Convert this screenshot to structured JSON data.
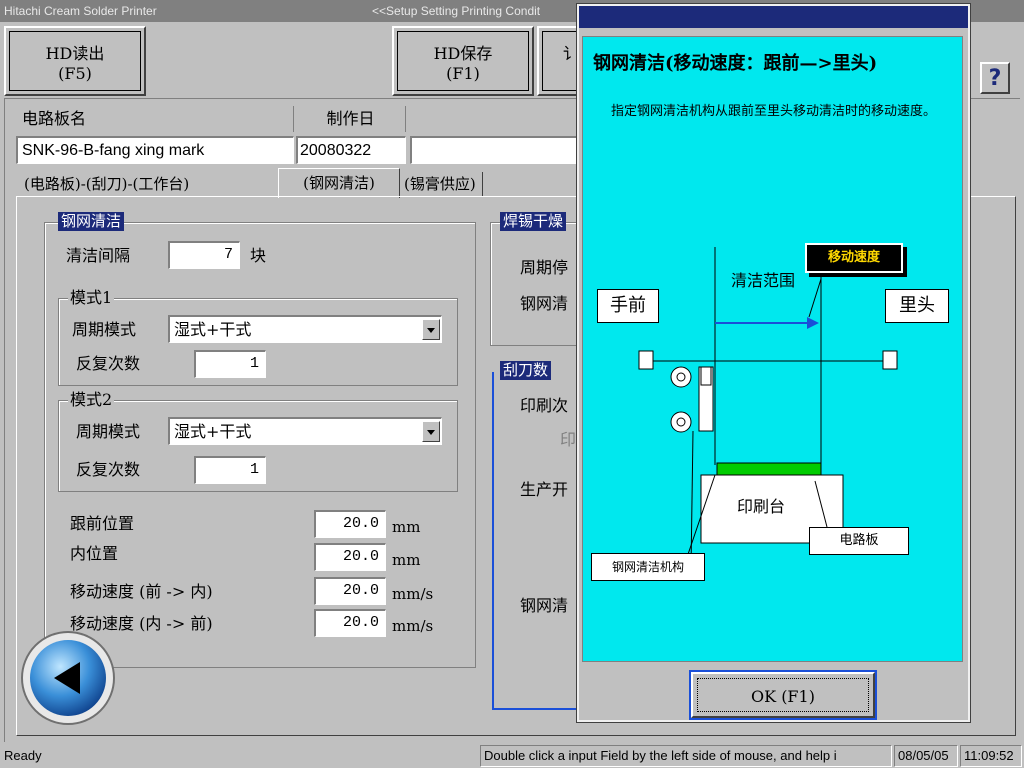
{
  "window": {
    "title": "Hitachi Cream Solder Printer",
    "subtitle": "<<Setup Setting Printing Condit"
  },
  "toolbar": {
    "hd_read_label": "HD读出",
    "hd_read_key": "(F5)",
    "hd_save_label": "HD保存",
    "hd_save_key": "(F1)",
    "partial_label": "讠"
  },
  "board": {
    "name_label": "电路板名",
    "name_value": "SNK-96-B-fang xing mark",
    "date_label": "制作日",
    "date_value": "20080322"
  },
  "tabs": [
    {
      "label": "(电路板)-(刮刀)-(工作台)"
    },
    {
      "label": "(钢网清洁)"
    },
    {
      "label": "(锡膏供应)"
    }
  ],
  "cleaning": {
    "title": "钢网清洁",
    "interval_label": "清洁间隔",
    "interval_value": "7",
    "interval_unit": "块",
    "mode1": {
      "title": "模式1",
      "cycle_label": "周期模式",
      "cycle_value": "湿式+干式",
      "repeat_label": "反复次数",
      "repeat_value": "1"
    },
    "mode2": {
      "title": "模式2",
      "cycle_label": "周期模式",
      "cycle_value": "湿式+干式",
      "repeat_label": "反复次数",
      "repeat_value": "1"
    },
    "front_pos_label": "跟前位置",
    "front_pos_value": "20.0",
    "front_pos_unit": "mm",
    "inner_pos_label": "内位置",
    "inner_pos_value": "20.0",
    "inner_pos_unit": "mm",
    "speed_in_label": "移动速度 (前 -> 内)",
    "speed_in_value": "20.0",
    "speed_in_unit": "mm/s",
    "speed_out_label": "移动速度 (内 -> 前)",
    "speed_out_value": "20.0",
    "speed_out_unit": "mm/s"
  },
  "right_panel": {
    "group1_title": "焊锡干燥",
    "group1_row1": "周期停",
    "group1_row2": "钢网清",
    "group2_title": "刮刀数",
    "group2_row1": "印刷次",
    "group2_row2": "印",
    "group2_row3": "生产开",
    "group2_row4": "钢网清"
  },
  "dialog": {
    "heading": "钢网清洁(移动速度：跟前—>里头)",
    "description": "指定钢网清洁机构从跟前至里头移动清洁时的移动速度。",
    "diagram": {
      "speed_tag": "移动速度",
      "range_label": "清洁范围",
      "front_label": "手前",
      "back_label": "里头",
      "table_label": "印刷台",
      "board_label": "电路板",
      "mechanism_label": "钢网清洁机构"
    },
    "ok_label": "OK (F1)"
  },
  "help_icon": "?",
  "status": {
    "ready": "Ready",
    "hint": "Double click a input Field by the left side of mouse, and help i",
    "date": "08/05/05",
    "time": "11:09:52"
  },
  "colors": {
    "title_blue": "#1c2a7a",
    "dialog_cyan": "#00e8ee",
    "board_green": "#00cc00",
    "arrow_blue": "#1a4fd8"
  }
}
